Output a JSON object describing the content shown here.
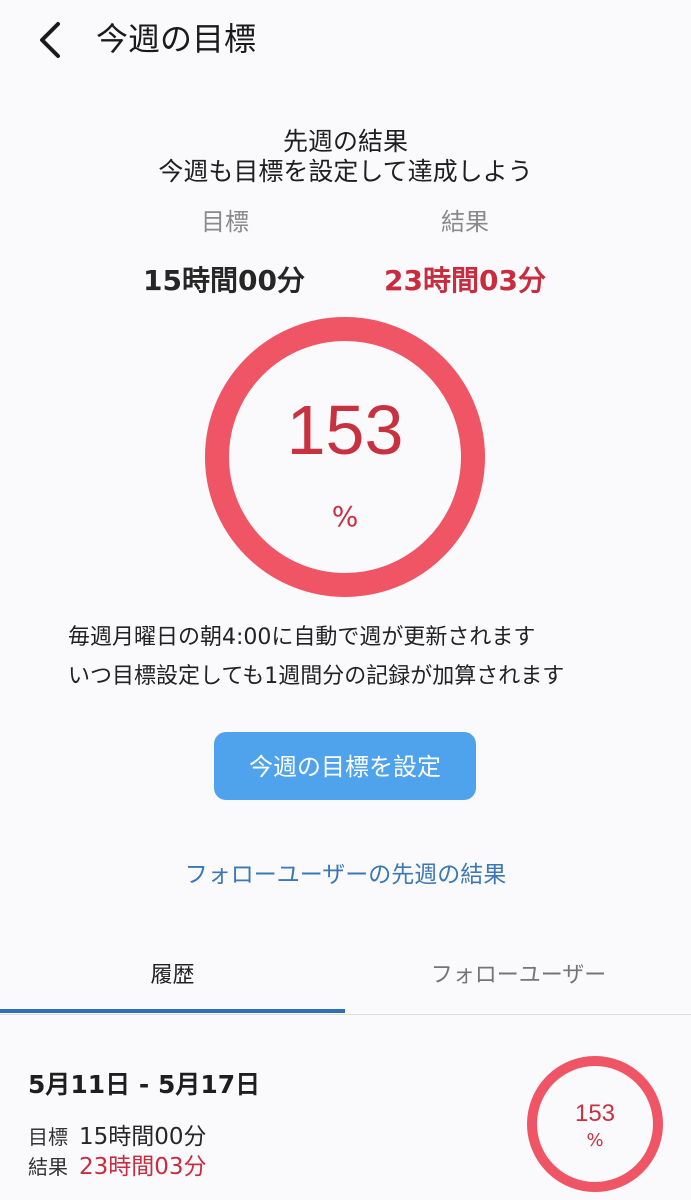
{
  "header": {
    "title": "今週の目標"
  },
  "summary": {
    "title": "先週の結果",
    "subtitle": "今週も目標を設定して達成しよう",
    "goal_label": "目標",
    "result_label": "結果",
    "goal_value": "15時間00分",
    "result_value": "23時間03分",
    "percent": "153",
    "percent_unit": "%",
    "progress_fraction": 1.0
  },
  "info": {
    "line1": "毎週月曜日の朝4:00に自動で週が更新されます",
    "line2": "いつ目標設定しても1週間分の記録が加算されます"
  },
  "set_goal_button": "今週の目標を設定",
  "follow_link": "フォローユーザーの先週の結果",
  "tabs": [
    {
      "label": "履歴",
      "active": true
    },
    {
      "label": "フォローユーザー",
      "active": false
    }
  ],
  "history": [
    {
      "range": "5月11日 - 5月17日",
      "goal_label": "目標",
      "goal_value": "15時間00分",
      "result_label": "結果",
      "result_value": "23時間03分",
      "percent": "153",
      "percent_unit": "%"
    }
  ],
  "colors": {
    "ring": "#ef5565",
    "accent_red": "#c82c3e",
    "button_blue": "#4ea3ec",
    "link_blue": "#3c77b7",
    "tab_indicator": "#2f6fb8"
  },
  "icons": {
    "back": "chevron-left-icon"
  }
}
